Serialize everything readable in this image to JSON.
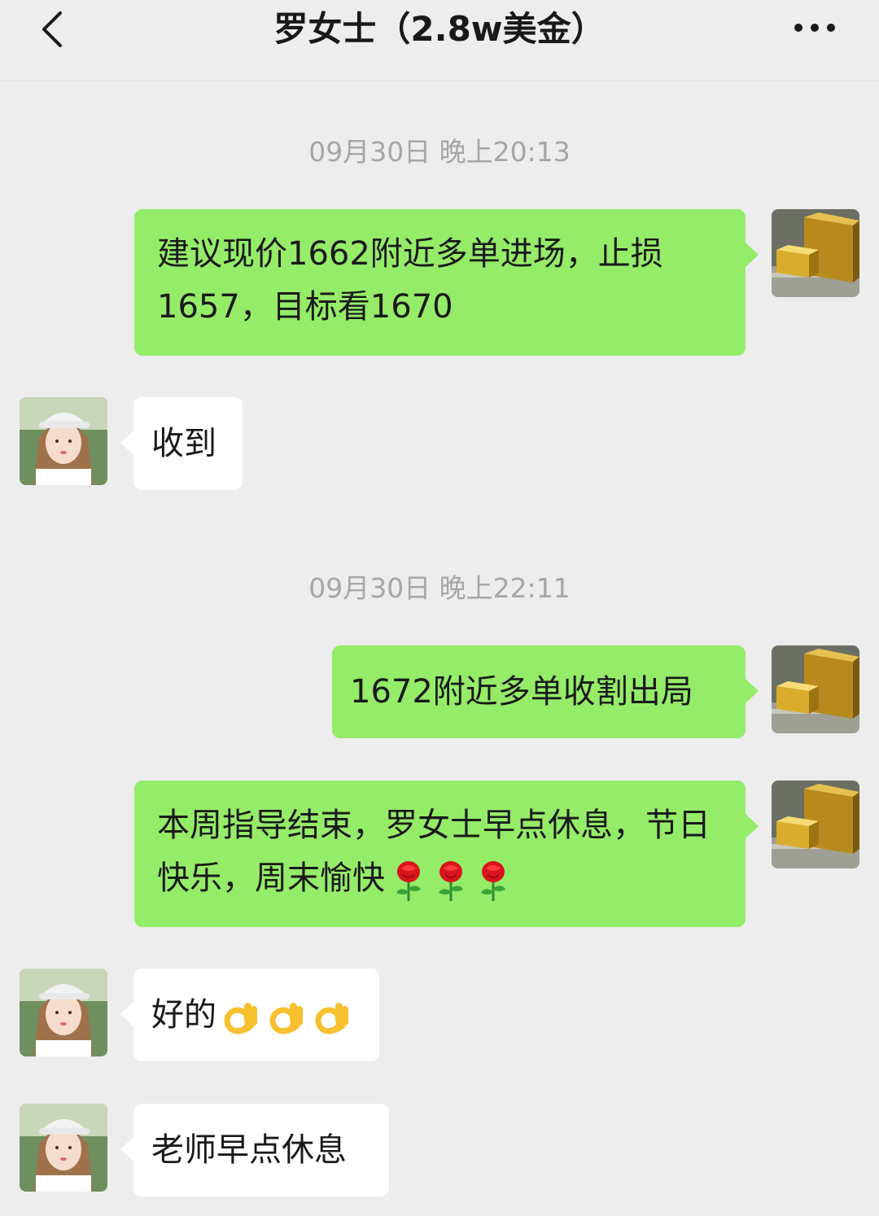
{
  "header": {
    "title": "罗女士（2.8w美金）",
    "back_icon": "chevron-left-icon",
    "more_icon": "more-dots-icon"
  },
  "timestamps": [
    "09月30日 晚上20:13",
    "09月30日 晚上22:11"
  ],
  "messages": [
    {
      "from": "me",
      "text": "建议现价1662附近多单进场，止损1657，目标看1670"
    },
    {
      "from": "contact",
      "text": "收到"
    },
    {
      "from": "me",
      "text": "1672附近多单收割出局"
    },
    {
      "from": "me",
      "text": "本周指导结束，罗女士早点休息，节日快乐，周末愉快",
      "emoji": "rose-icon",
      "emoji_count": 3
    },
    {
      "from": "contact",
      "text": "好的",
      "emoji": "ok-hand-icon",
      "emoji_count": 3
    },
    {
      "from": "contact",
      "text": "老师早点休息"
    }
  ],
  "colors": {
    "background": "#ededed",
    "outgoing_bubble": "#95ec69",
    "incoming_bubble": "#ffffff",
    "timestamp": "#a6a6a6",
    "text": "#191919"
  }
}
